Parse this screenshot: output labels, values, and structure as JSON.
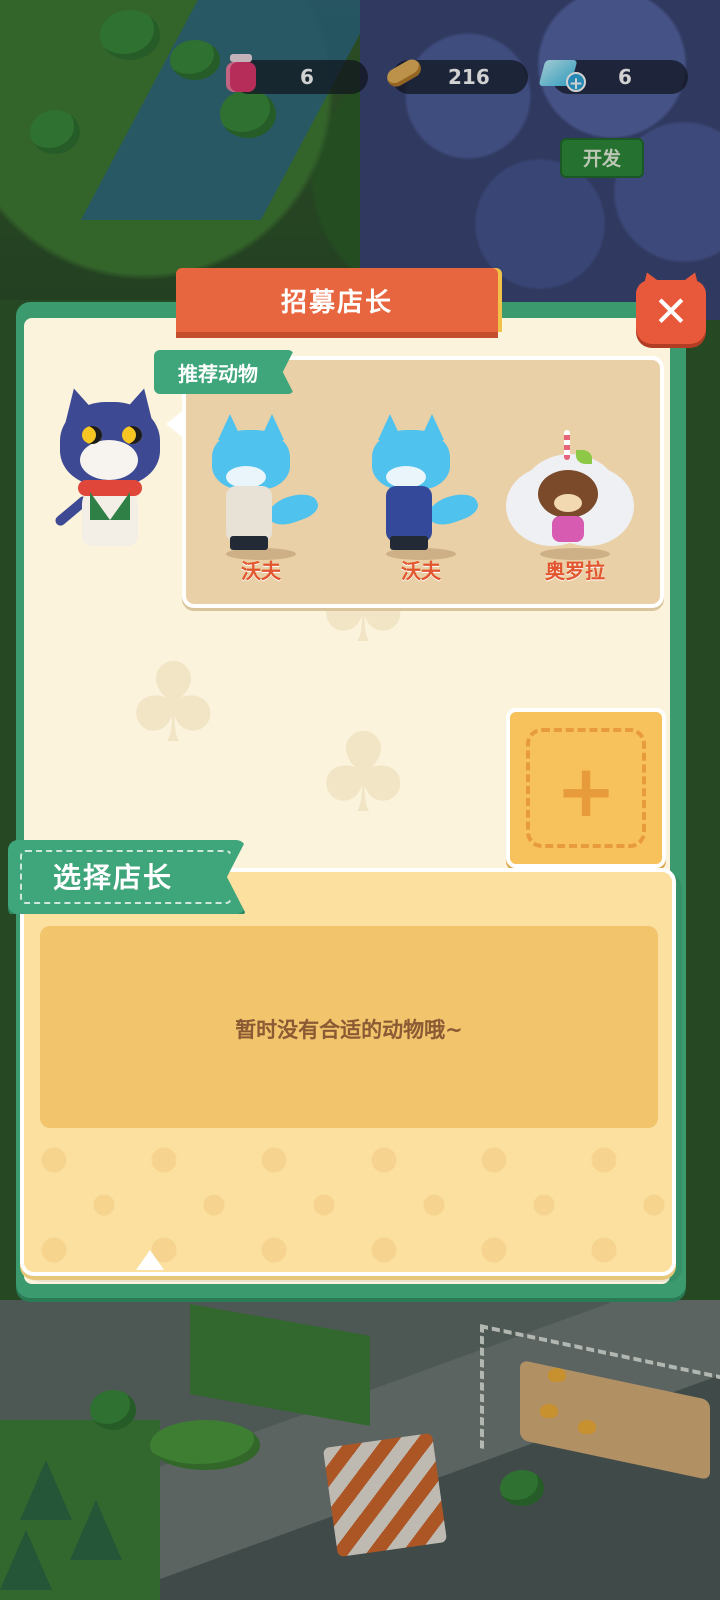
{
  "currency": {
    "jam": {
      "icon": "jam-jar-icon",
      "value": "6"
    },
    "wood": {
      "icon": "wood-log-icon",
      "value": "216"
    },
    "gems": {
      "icon": "diamond-plus-icon",
      "value": "6"
    }
  },
  "world": {
    "develop_button": "开发"
  },
  "dialog": {
    "title": "招募店长",
    "close_icon": "close-x-icon",
    "recommended": {
      "label": "推荐动物",
      "animals": [
        {
          "name": "沃夫",
          "icon": "wolf-icon",
          "coat_color": "#e8e2d6"
        },
        {
          "name": "沃夫",
          "icon": "wolf-icon",
          "coat_color": "#34499a"
        },
        {
          "name": "奥罗拉",
          "icon": "bear-icon"
        }
      ]
    },
    "add_slot_icon": "plus-icon",
    "choose": {
      "label": "选择店长",
      "empty_message": "暂时没有合适的动物哦~"
    }
  },
  "colors": {
    "frame_green": "#3b9a6e",
    "title_orange": "#e8663f",
    "accent_yellow": "#f7c15b",
    "animal_name_red": "#e2552f"
  }
}
